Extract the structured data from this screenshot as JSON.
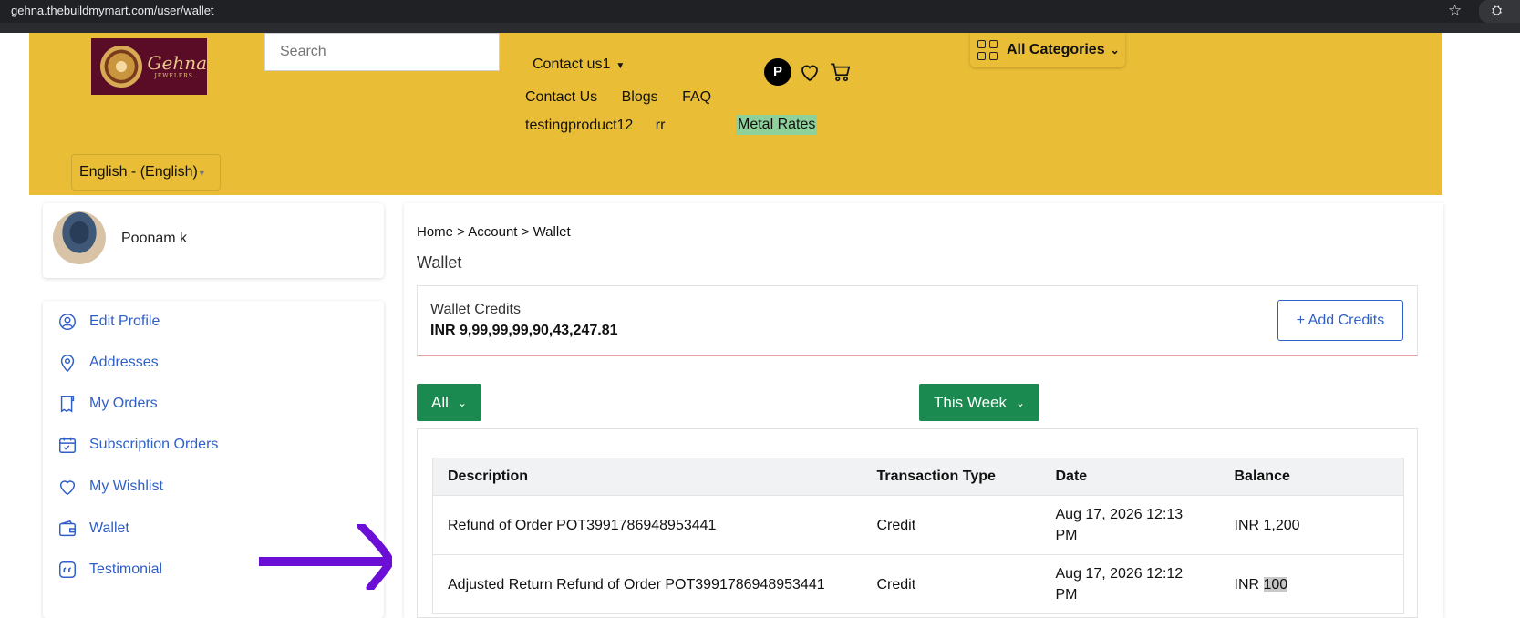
{
  "browser": {
    "url": "gehna.thebuildmymart.com/user/wallet"
  },
  "header": {
    "brand_name": "Gehna",
    "brand_sub": "JEWELERS",
    "search_placeholder": "Search",
    "contact_dropdown": "Contact us1",
    "nav_links": [
      "Contact Us",
      "Blogs",
      "FAQ"
    ],
    "nav_links2": [
      "testingproduct12",
      "rr"
    ],
    "metal_rates": "Metal Rates",
    "user_initial": "P",
    "all_categories": "All Categories",
    "language": "English - (English)"
  },
  "sidebar": {
    "user_name": "Poonam k",
    "items": [
      {
        "label": "Edit Profile",
        "icon": "user-icon"
      },
      {
        "label": "Addresses",
        "icon": "location-pin-icon"
      },
      {
        "label": "My Orders",
        "icon": "orders-icon"
      },
      {
        "label": "Subscription Orders",
        "icon": "calendar-icon"
      },
      {
        "label": "My Wishlist",
        "icon": "heart-icon"
      },
      {
        "label": "Wallet",
        "icon": "wallet-icon"
      },
      {
        "label": "Testimonial",
        "icon": "quote-icon"
      }
    ]
  },
  "main": {
    "breadcrumb": "Home > Account > Wallet",
    "title": "Wallet",
    "credits_label": "Wallet Credits",
    "credits_amount": "INR 9,99,99,99,90,43,247.81",
    "add_credits": "+ Add Credits",
    "filter_type": "All",
    "filter_period": "This Week",
    "table": {
      "headers": [
        "Description",
        "Transaction Type",
        "Date",
        "Balance"
      ],
      "rows": [
        {
          "description": "Refund of Order POT3991786948953441",
          "type": "Credit",
          "date": "Aug 17, 2026 12:13 PM",
          "balance_prefix": "INR ",
          "balance_value": "1,200"
        },
        {
          "description": "Adjusted Return Refund of Order POT3991786948953441",
          "type": "Credit",
          "date": "Aug 17, 2026 12:12 PM",
          "balance_prefix": "INR ",
          "balance_value": "100"
        }
      ]
    }
  },
  "colors": {
    "header_bg": "#e9bd35",
    "accent_green": "#1b8a50",
    "link_blue": "#2f5fc7",
    "arrow_purple": "#6b0fd6"
  }
}
